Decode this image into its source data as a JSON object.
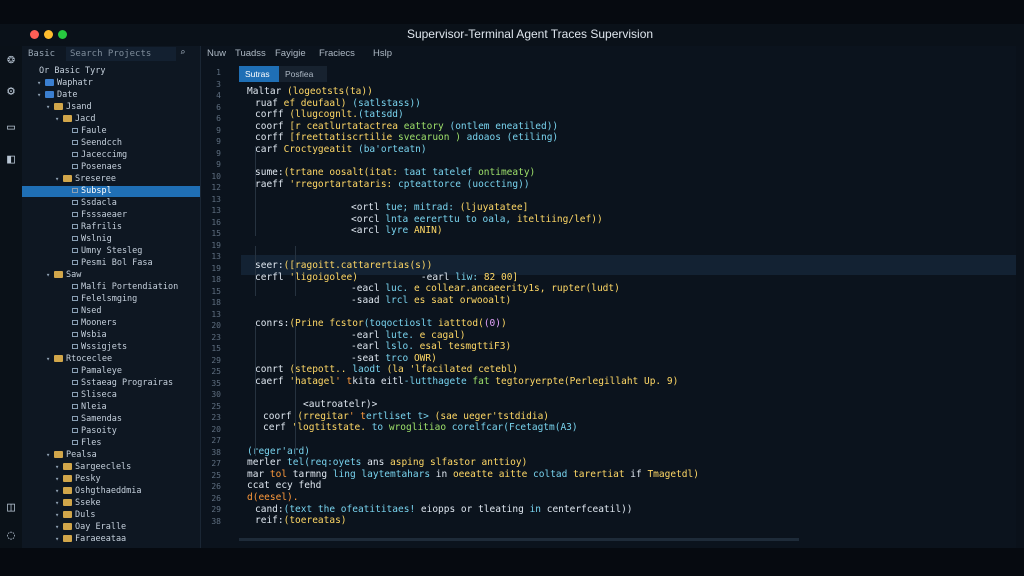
{
  "window": {
    "title": "Supervisor-Terminal Agent Traces Supervision"
  },
  "sidebar": {
    "header_label": "Basic",
    "search_value": "Search Projects",
    "items": [
      {
        "label": "Or Basic Tyry",
        "depth": 0,
        "kind": "text"
      },
      {
        "label": "Waphatr",
        "depth": 1,
        "kind": "blue"
      },
      {
        "label": "Date",
        "depth": 1,
        "kind": "blue"
      },
      {
        "label": "Jsand",
        "depth": 2,
        "kind": "folder"
      },
      {
        "label": "Jacd",
        "depth": 3,
        "kind": "folder"
      },
      {
        "label": "Faule",
        "depth": 4,
        "kind": "file"
      },
      {
        "label": "Seendcch",
        "depth": 4,
        "kind": "file"
      },
      {
        "label": "Jaceccimg",
        "depth": 4,
        "kind": "file"
      },
      {
        "label": "Posenaes",
        "depth": 4,
        "kind": "file"
      },
      {
        "label": "Sreseree",
        "depth": 3,
        "kind": "folder"
      },
      {
        "label": "Subspl",
        "depth": 4,
        "kind": "file",
        "selected": true
      },
      {
        "label": "Ssdacla",
        "depth": 4,
        "kind": "file"
      },
      {
        "label": "Fsssaeaer",
        "depth": 4,
        "kind": "file"
      },
      {
        "label": "Rafrilis",
        "depth": 4,
        "kind": "file"
      },
      {
        "label": "Wslnig",
        "depth": 4,
        "kind": "file"
      },
      {
        "label": "Umny Stesleg",
        "depth": 4,
        "kind": "file"
      },
      {
        "label": "Pesmi Bol Fasa",
        "depth": 4,
        "kind": "file"
      },
      {
        "label": "Saw",
        "depth": 2,
        "kind": "folder"
      },
      {
        "label": "Malfi Portendiation",
        "depth": 4,
        "kind": "file"
      },
      {
        "label": "Felelsmging",
        "depth": 4,
        "kind": "file"
      },
      {
        "label": "Nsed",
        "depth": 4,
        "kind": "file"
      },
      {
        "label": "Mooners",
        "depth": 4,
        "kind": "file"
      },
      {
        "label": "Wsbia",
        "depth": 4,
        "kind": "file"
      },
      {
        "label": "Wssigjets",
        "depth": 4,
        "kind": "file"
      },
      {
        "label": "Rtoceclee",
        "depth": 2,
        "kind": "folder"
      },
      {
        "label": "Pamaleye",
        "depth": 4,
        "kind": "file"
      },
      {
        "label": "Sstaeag Prograiras",
        "depth": 4,
        "kind": "file"
      },
      {
        "label": "Sliseca",
        "depth": 4,
        "kind": "file"
      },
      {
        "label": "Nleia",
        "depth": 4,
        "kind": "file"
      },
      {
        "label": "Samendas",
        "depth": 4,
        "kind": "file"
      },
      {
        "label": "Pasoity",
        "depth": 4,
        "kind": "file"
      },
      {
        "label": "Fles",
        "depth": 4,
        "kind": "file"
      },
      {
        "label": "Pealsa",
        "depth": 2,
        "kind": "folder"
      },
      {
        "label": "Sargeeclels",
        "depth": 3,
        "kind": "folder"
      },
      {
        "label": "Pesky",
        "depth": 3,
        "kind": "folder"
      },
      {
        "label": "Oshgthaeddmia",
        "depth": 3,
        "kind": "folder"
      },
      {
        "label": "Sseke",
        "depth": 3,
        "kind": "folder"
      },
      {
        "label": "Duls",
        "depth": 3,
        "kind": "folder"
      },
      {
        "label": "Oay Eralle",
        "depth": 3,
        "kind": "folder"
      },
      {
        "label": "Faraeeataa",
        "depth": 3,
        "kind": "folder"
      }
    ]
  },
  "menubar": [
    "Nuw",
    "Tuadss",
    "Fayigie",
    "Fraciecs",
    "Hslp"
  ],
  "tabs": [
    {
      "label": "Sutras",
      "active": true
    },
    {
      "label": "Posfiea",
      "active": false
    }
  ],
  "line_numbers": [
    "1",
    "3",
    "4",
    "6",
    "6",
    "9",
    "9",
    "9",
    "9",
    "10",
    "12",
    "13",
    "13",
    "16",
    "15",
    "19",
    "13",
    "19",
    "18",
    "15",
    "18",
    "13",
    "20",
    "23",
    "15",
    "29",
    "25",
    "35",
    "30",
    "25",
    "23",
    "20",
    "27",
    "38",
    "27",
    "25",
    "26",
    "26",
    "29",
    "38"
  ],
  "code_lines": [
    {
      "indent": 0,
      "parts": [
        [
          "w",
          "Maltar "
        ],
        [
          "y",
          "(logeotsts(ta))"
        ]
      ]
    },
    {
      "indent": 1,
      "parts": [
        [
          "w",
          "ruaf "
        ],
        [
          "y",
          "ef deufaal) "
        ],
        [
          "c",
          "(satlstass))"
        ]
      ]
    },
    {
      "indent": 1,
      "parts": [
        [
          "w",
          "corff "
        ],
        [
          "y",
          "(llugcognlt."
        ],
        [
          "c",
          "(tatsdd)"
        ]
      ]
    },
    {
      "indent": 1,
      "parts": [
        [
          "w",
          "coorf "
        ],
        [
          "y",
          "[r ceatlurtatactrea "
        ],
        [
          "g",
          "eattory "
        ],
        [
          "c",
          "(ontlem eneatiled))"
        ]
      ]
    },
    {
      "indent": 1,
      "parts": [
        [
          "w",
          "corff "
        ],
        [
          "y",
          "[freettatiscrtilie "
        ],
        [
          "g",
          "svecaruon ) "
        ],
        [
          "c",
          "adoaos (etiling)"
        ]
      ]
    },
    {
      "indent": 1,
      "parts": [
        [
          "w",
          "carf "
        ],
        [
          "y",
          "Croctygeatit "
        ],
        [
          "c",
          "(ba'orteatn)"
        ]
      ]
    },
    {
      "indent": 0,
      "parts": []
    },
    {
      "indent": 1,
      "parts": [
        [
          "w",
          "sume:"
        ],
        [
          "y",
          "(trtane oosalt(itat: "
        ],
        [
          "c",
          "taat tatelef "
        ],
        [
          "g",
          "ontimeaty)"
        ]
      ]
    },
    {
      "indent": 1,
      "parts": [
        [
          "w",
          "raeff "
        ],
        [
          "y",
          "'rregortartataris: "
        ],
        [
          "c",
          "cpteattorce (uoccting))"
        ]
      ]
    },
    {
      "indent": 0,
      "parts": []
    },
    {
      "indent": 13,
      "parts": [
        [
          "w",
          "<ortl "
        ],
        [
          "c",
          "tue; mitrad: "
        ],
        [
          "y",
          "(ljuyatatee]"
        ]
      ]
    },
    {
      "indent": 13,
      "parts": [
        [
          "w",
          "<orcl "
        ],
        [
          "c",
          "lnta eererttu to oala, "
        ],
        [
          "y",
          "iteltiing/lef))"
        ]
      ]
    },
    {
      "indent": 13,
      "parts": [
        [
          "w",
          "<arcl "
        ],
        [
          "c",
          "lyre "
        ],
        [
          "y",
          "ANIN)"
        ]
      ]
    },
    {
      "indent": 0,
      "parts": []
    },
    {
      "indent": 0,
      "parts": []
    },
    {
      "indent": 1,
      "parts": [
        [
          "w",
          "seer:"
        ],
        [
          "y",
          "([ragoitt.cattarertias(s))"
        ]
      ]
    },
    {
      "indent": 1,
      "parts": [
        [
          "w",
          "cerfl "
        ],
        [
          "y",
          "'ligoigolee) "
        ],
        [
          "w",
          "          -earl "
        ],
        [
          "c",
          "liw: "
        ],
        [
          "y",
          "82 00]"
        ]
      ]
    },
    {
      "indent": 13,
      "parts": [
        [
          "w",
          "-eacl "
        ],
        [
          "c",
          "luc. "
        ],
        [
          "y",
          "e collear.ancaeerity1s, rupter(ludt)"
        ]
      ]
    },
    {
      "indent": 13,
      "parts": [
        [
          "w",
          "-saad "
        ],
        [
          "c",
          "lrcl "
        ],
        [
          "y",
          "es saat orwooalt)"
        ]
      ]
    },
    {
      "indent": 0,
      "parts": []
    },
    {
      "indent": 1,
      "parts": [
        [
          "w",
          "conrs:"
        ],
        [
          "y",
          "(Prine fcstor"
        ],
        [
          "c",
          "(toqoctioslt "
        ],
        [
          "y",
          "iatttod("
        ],
        [
          "p",
          "(0)"
        ],
        [
          "y",
          ")"
        ]
      ]
    },
    {
      "indent": 13,
      "parts": [
        [
          "w",
          "-earl "
        ],
        [
          "c",
          "lute. "
        ],
        [
          "y",
          "e cagal)"
        ]
      ]
    },
    {
      "indent": 13,
      "parts": [
        [
          "w",
          "-earl "
        ],
        [
          "c",
          "lslo. "
        ],
        [
          "y",
          "esal tesmgttiF3)"
        ]
      ]
    },
    {
      "indent": 13,
      "parts": [
        [
          "w",
          "-seat "
        ],
        [
          "c",
          "trco "
        ],
        [
          "y",
          "OWR)"
        ]
      ]
    },
    {
      "indent": 1,
      "parts": [
        [
          "w",
          "conrt "
        ],
        [
          "y",
          "(stepott.. "
        ],
        [
          "c",
          "laodt "
        ],
        [
          "y",
          "(la 'lfacilated cetebl)"
        ]
      ]
    },
    {
      "indent": 1,
      "parts": [
        [
          "w",
          "caerf "
        ],
        [
          "y",
          "'hatagel"
        ],
        [
          "o",
          "' t"
        ],
        [
          "w",
          "kita eitl"
        ],
        [
          "c",
          "-lutthagete "
        ],
        [
          "g",
          "fat "
        ],
        [
          "y",
          "tegtoryerpte(Perlegillaht Up. 9)"
        ]
      ]
    },
    {
      "indent": 0,
      "parts": []
    },
    {
      "indent": 7,
      "parts": [
        [
          "w",
          "<autroatelr)>"
        ]
      ]
    },
    {
      "indent": 2,
      "parts": [
        [
          "w",
          "coorf "
        ],
        [
          "y",
          "(rregitar"
        ],
        [
          "o",
          "' t"
        ],
        [
          "c",
          "ertliset t> "
        ],
        [
          "y",
          "(sae ueger'tstdidia)"
        ]
      ]
    },
    {
      "indent": 2,
      "parts": [
        [
          "w",
          "cerf "
        ],
        [
          "y",
          "'logtitstate. "
        ],
        [
          "c",
          "to "
        ],
        [
          "g",
          "wroglitiao "
        ],
        [
          "c",
          "corelfcar(Fcetagtm(A3)"
        ]
      ]
    },
    {
      "indent": 0,
      "parts": []
    },
    {
      "indent": 0,
      "parts": [
        [
          "c",
          "(reger'ard)"
        ]
      ]
    },
    {
      "indent": 0,
      "parts": [
        [
          "w",
          "merler "
        ],
        [
          "c",
          "tel(req:oyets "
        ],
        [
          "w",
          "ans "
        ],
        [
          "y",
          "asping slfastor anttioy)"
        ]
      ]
    },
    {
      "indent": 0,
      "parts": [
        [
          "w",
          "mar "
        ],
        [
          "o",
          "tol "
        ],
        [
          "w",
          "tarmng "
        ],
        [
          "c",
          "ling laytemtahars "
        ],
        [
          "w",
          "in "
        ],
        [
          "y",
          "oeeatte aitte "
        ],
        [
          "c",
          "coltad "
        ],
        [
          "y",
          "tarertiat "
        ],
        [
          "w",
          "if "
        ],
        [
          "y",
          "Tmagetdl)"
        ]
      ]
    },
    {
      "indent": 0,
      "parts": [
        [
          "w",
          "ccat ecy fehd"
        ]
      ]
    },
    {
      "indent": 0,
      "parts": [
        [
          "o",
          "d(eesel)."
        ]
      ]
    },
    {
      "indent": 1,
      "parts": [
        [
          "w",
          "cand:"
        ],
        [
          "c",
          "(text the ofeatititaes! "
        ],
        [
          "w",
          "eiopps or tleating "
        ],
        [
          "c",
          "in "
        ],
        [
          "w",
          "centerfceatil))"
        ]
      ]
    },
    {
      "indent": 1,
      "parts": [
        [
          "w",
          "reif:"
        ],
        [
          "y",
          "(toereatas)"
        ]
      ]
    }
  ]
}
